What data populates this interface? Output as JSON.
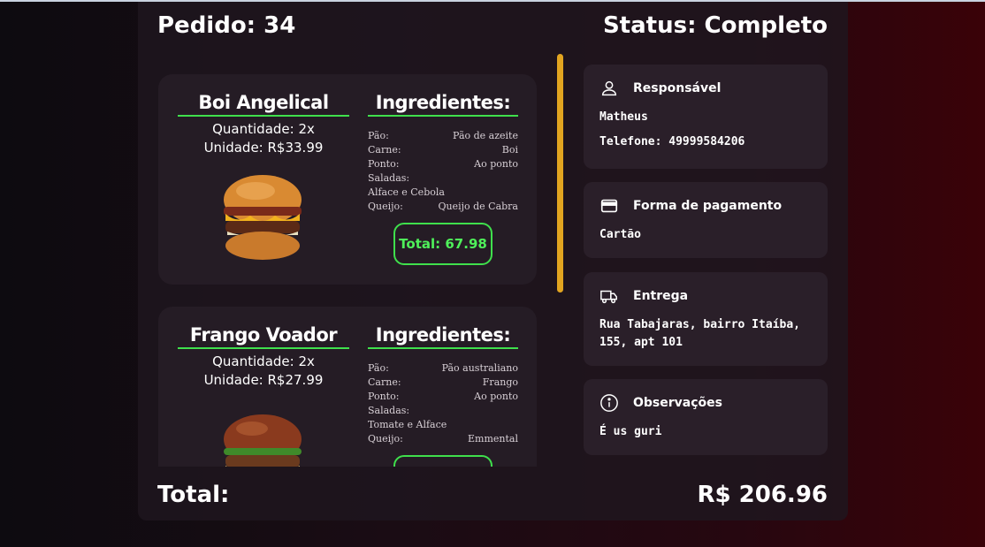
{
  "order": {
    "label": "Pedido: 34",
    "status": "Status: Completo"
  },
  "items": [
    {
      "name": "Boi Angelical",
      "quantity": "Quantidade: 2x",
      "unit": "Unidade: R$33.99",
      "ing_title": "Ingredientes:",
      "ingredients": {
        "pao_label": "Pão:",
        "pao": "Pão de azeite",
        "carne_label": "Carne:",
        "carne": "Boi",
        "ponto_label": "Ponto:",
        "ponto": "Ao ponto",
        "saladas_label": "Saladas:",
        "saladas": "Alface e Cebola",
        "queijo_label": "Queijo:",
        "queijo": "Queijo de Cabra"
      },
      "total": "Total: 67.98"
    },
    {
      "name": "Frango Voador",
      "quantity": "Quantidade: 2x",
      "unit": "Unidade: R$27.99",
      "ing_title": "Ingredientes:",
      "ingredients": {
        "pao_label": "Pão:",
        "pao": "Pão australiano",
        "carne_label": "Carne:",
        "carne": "Frango",
        "ponto_label": "Ponto:",
        "ponto": "Ao ponto",
        "saladas_label": "Saladas:",
        "saladas": "Tomate e Alface",
        "queijo_label": "Queijo:",
        "queijo": "Emmental"
      },
      "total": ""
    }
  ],
  "info": {
    "responsavel": {
      "title": "Responsável",
      "name": "Matheus",
      "phone": "Telefone: 49999584206",
      "icon": "user-icon"
    },
    "pagamento": {
      "title": "Forma de pagamento",
      "value": "Cartão",
      "icon": "credit-card-icon"
    },
    "entrega": {
      "title": "Entrega",
      "line1": "Rua Tabajaras, bairro Itaíba,",
      "line2": "155, apt 101",
      "icon": "truck-icon"
    },
    "observacoes": {
      "title": "Observações",
      "value": "É us guri",
      "icon": "info-icon"
    }
  },
  "footer": {
    "label": "Total:",
    "value": "R$ 206.96"
  },
  "colors": {
    "accent_green": "#3fe04c",
    "scrollbar": "#e2a520"
  }
}
